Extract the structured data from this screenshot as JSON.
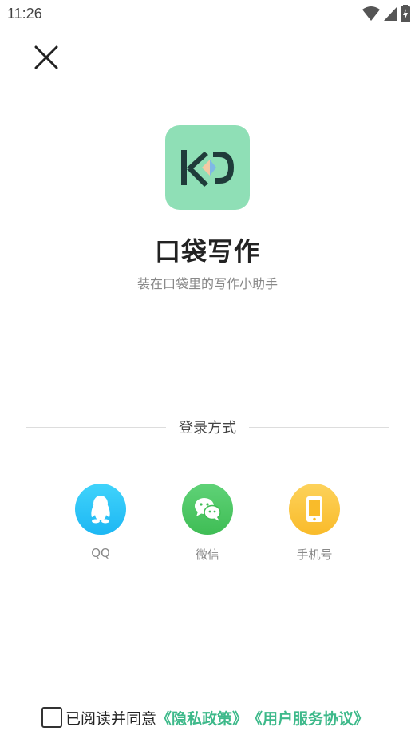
{
  "status_bar": {
    "time": "11:26"
  },
  "app": {
    "name": "口袋写作",
    "slogan": "装在口袋里的写作小助手",
    "logo_bg": "#8fdfb6"
  },
  "login": {
    "divider_label": "登录方式",
    "options": [
      {
        "label": "QQ",
        "icon": "qq-penguin-icon",
        "color": "#2ec5f6"
      },
      {
        "label": "微信",
        "icon": "wechat-icon",
        "color": "#4cc962"
      },
      {
        "label": "手机号",
        "icon": "phone-icon",
        "color": "#fcc93c"
      }
    ]
  },
  "agreement": {
    "prefix": "已阅读并同意",
    "privacy_policy": "《隐私政策》",
    "user_agreement": "《用户服务协议》",
    "link_color": "#3db98a"
  }
}
